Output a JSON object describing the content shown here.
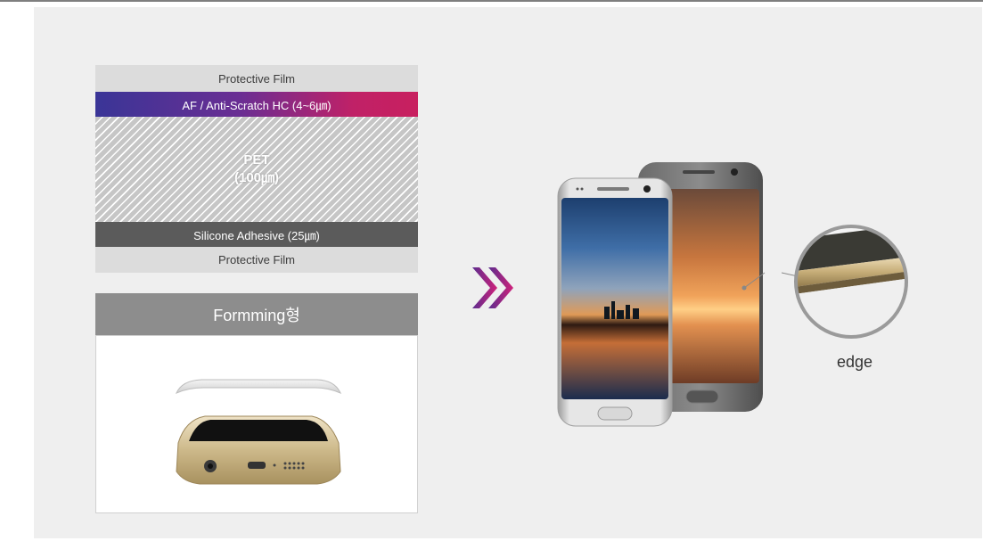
{
  "layers": {
    "protective_film_top": "Protective Film",
    "af_hardcoat": "AF / Anti-Scratch HC (4~6㎛)",
    "pet_name": "PET",
    "pet_thickness": "(100㎛)",
    "silicone_adhesive": "Silicone Adhesive (25㎛)",
    "protective_film_bottom": "Protective Film"
  },
  "forming": {
    "title": "Formming형"
  },
  "callout": {
    "edge_label": "edge"
  },
  "colors": {
    "af_gradient_start": "#3a3597",
    "af_gradient_end": "#c8205f",
    "chevron_start": "#5b2d8e",
    "chevron_end": "#d0217a",
    "adhesive": "#5b5b5b",
    "protective_film": "#dcdcdc"
  },
  "icons": {
    "arrow": "double-chevron-right-icon"
  }
}
